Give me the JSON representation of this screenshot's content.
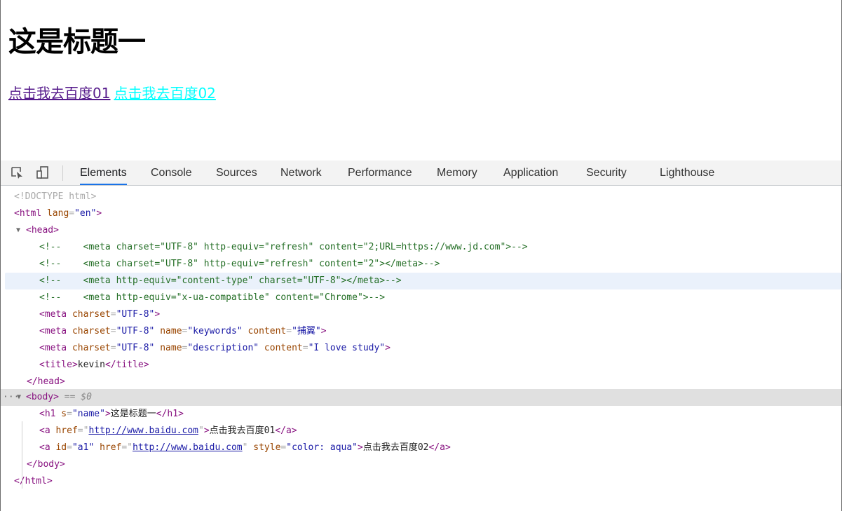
{
  "page": {
    "heading": "这是标题一",
    "link1": "点击我去百度01",
    "link2": "点击我去百度02"
  },
  "devtools": {
    "tabs": [
      "Elements",
      "Console",
      "Sources",
      "Network",
      "Performance",
      "Memory",
      "Application",
      "Security",
      "Lighthouse"
    ],
    "active_tab": "Elements",
    "icons": {
      "inspect": "select-element-icon",
      "device": "device-toolbar-icon"
    },
    "dom": {
      "doctype": "<!DOCTYPE html>",
      "html_open": "<html",
      "lang_attr": " lang",
      "lang_val": "\"en\"",
      "head_tag": "<head>",
      "comment1": "<!--    <meta charset=\"UTF-8\" http-equiv=\"refresh\" content=\"2;URL=https://www.jd.com\">-->",
      "comment2": "<!--    <meta charset=\"UTF-8\" http-equiv=\"refresh\" content=\"2\"></meta>-->",
      "comment3": "<!--    <meta http-equiv=\"content-type\" charset=\"UTF-8\"></meta>-->",
      "comment4": "<!--    <meta http-equiv=\"x-ua-compatible\" content=\"Chrome\">-->",
      "meta1_tag": "<meta",
      "charset_attr": " charset",
      "charset_val": "\"UTF-8\"",
      "name_attr": " name",
      "keywords_val": "\"keywords\"",
      "content_attr": " content",
      "keywords_content": "\"捕翼\"",
      "description_val": "\"description\"",
      "description_content": "\"I love study\"",
      "title_open": "<title>",
      "title_text": "kevin",
      "title_close": "</title>",
      "head_close": "</head>",
      "body_tag": "<body>",
      "eq_dollar": " == $0",
      "h1_open": "<h1",
      "s_attr": " s",
      "s_val": "\"name\"",
      "h1_text": "这是标题一",
      "h1_close": "</h1>",
      "a_open": "<a",
      "href_attr": " href",
      "href_val": "http://www.baidu.com",
      "a1_text": "点击我去百度01",
      "a_close": "</a>",
      "id_attr": " id",
      "id_val": "\"a1\"",
      "style_attr": " style",
      "style_val": "\"color: aqua\"",
      "a2_text": "点击我去百度02",
      "body_close": "</body>",
      "html_close": "</html>"
    }
  },
  "colors": {
    "tag": "#881280",
    "attr_name": "#994500",
    "attr_value": "#1a1aa6",
    "comment": "#236e25",
    "active_tab_underline": "#1a73e8",
    "aqua_link": "#00ffff",
    "visited_link": "#551a8b"
  }
}
